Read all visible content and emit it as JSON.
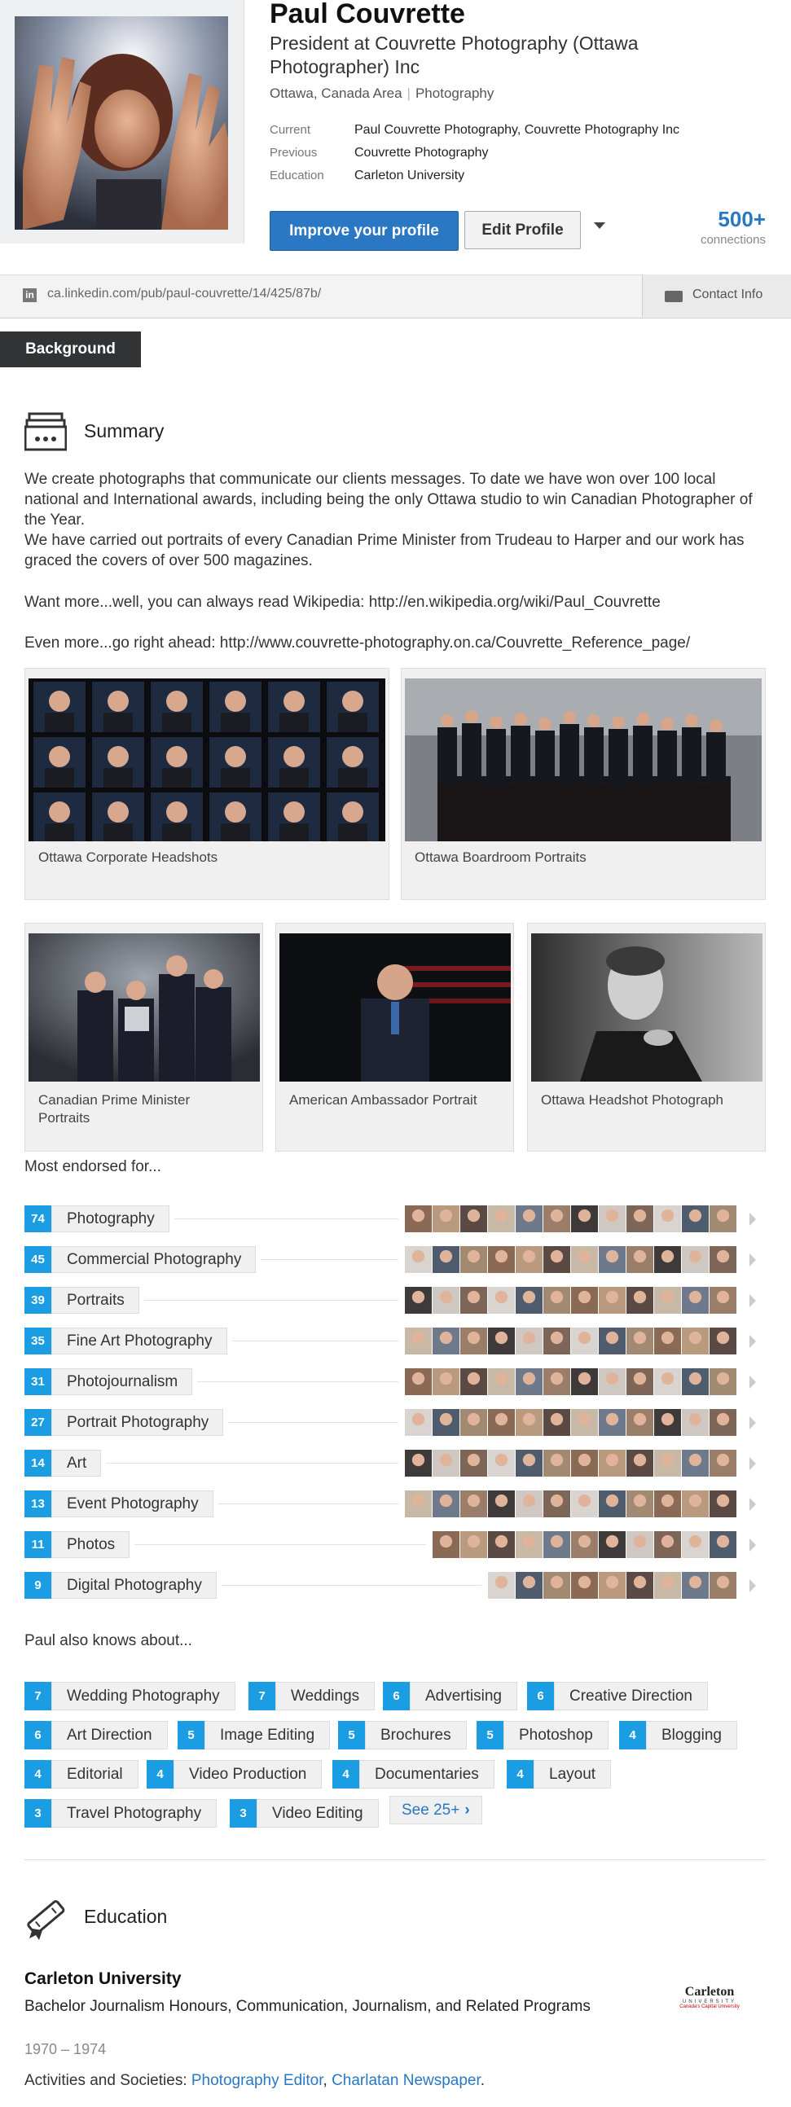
{
  "profile": {
    "name": "Paul Couvrette",
    "headline": "President at Couvrette Photography (Ottawa Photographer) Inc",
    "location": "Ottawa, Canada Area",
    "industry": "Photography",
    "meta": [
      {
        "key": "Current",
        "value": "Paul Couvrette Photography, Couvrette Photography Inc"
      },
      {
        "key": "Previous",
        "value": "Couvrette Photography"
      },
      {
        "key": "Education",
        "value": "Carleton University"
      }
    ],
    "improve_label": "Improve your profile",
    "edit_label": "Edit Profile",
    "connections_count": "500+",
    "connections_label": "connections",
    "public_url": "ca.linkedin.com/pub/paul-couvrette/14/425/87b/",
    "url_icon": "in",
    "contact_label": "Contact Info"
  },
  "tabs": {
    "background": "Background"
  },
  "summary": {
    "title": "Summary",
    "p1": "We create photographs that communicate our clients messages. To date we have won over 100 local national and International awards, including being the only Ottawa studio to win Canadian Photographer of the Year.",
    "p2": "We have carried out portraits of every Canadian Prime Minister from Trudeau to Harper and our work has graced the covers of over 500 magazines.",
    "p3": "Want more...well, you can always read Wikipedia: http://en.wikipedia.org/wiki/Paul_Couvrette",
    "p4": "Even more...go right ahead: http://www.couvrette-photography.on.ca/Couvrette_Reference_page/",
    "media": [
      {
        "caption": "Ottawa Corporate Headshots"
      },
      {
        "caption": "Ottawa Boardroom Portraits"
      },
      {
        "caption": "Canadian Prime Minister Portraits"
      },
      {
        "caption": "American Ambassador Portrait"
      },
      {
        "caption": "Ottawa Headshot Photograph"
      }
    ]
  },
  "endorsements": {
    "title": "Most endorsed for...",
    "skills": [
      {
        "count": "74",
        "name": "Photography"
      },
      {
        "count": "45",
        "name": "Commercial Photography"
      },
      {
        "count": "39",
        "name": "Portraits"
      },
      {
        "count": "35",
        "name": "Fine Art Photography"
      },
      {
        "count": "31",
        "name": "Photojournalism"
      },
      {
        "count": "27",
        "name": "Portrait Photography"
      },
      {
        "count": "14",
        "name": "Art"
      },
      {
        "count": "13",
        "name": "Event Photography"
      },
      {
        "count": "11",
        "name": "Photos"
      },
      {
        "count": "9",
        "name": "Digital Photography"
      }
    ]
  },
  "knows": {
    "title": "Paul also knows about...",
    "chips": [
      {
        "count": "7",
        "name": "Wedding Photography"
      },
      {
        "count": "7",
        "name": "Weddings"
      },
      {
        "count": "6",
        "name": "Advertising"
      },
      {
        "count": "6",
        "name": "Creative Direction"
      },
      {
        "count": "6",
        "name": "Art Direction"
      },
      {
        "count": "5",
        "name": "Image Editing"
      },
      {
        "count": "5",
        "name": "Brochures"
      },
      {
        "count": "5",
        "name": "Photoshop"
      },
      {
        "count": "4",
        "name": "Blogging"
      },
      {
        "count": "4",
        "name": "Editorial"
      },
      {
        "count": "4",
        "name": "Video Production"
      },
      {
        "count": "4",
        "name": "Documentaries"
      },
      {
        "count": "4",
        "name": "Layout"
      },
      {
        "count": "3",
        "name": "Travel Photography"
      },
      {
        "count": "3",
        "name": "Video Editing"
      }
    ],
    "see_more": "See 25+"
  },
  "education": {
    "title": "Education",
    "school": "Carleton University",
    "degree": "Bachelor Journalism Honours, Communication, Journalism, and Related Programs",
    "years": "1970 – 1974",
    "activities_label": "Activities and Societies:",
    "activities": [
      "Photography Editor",
      "Charlatan Newspaper"
    ],
    "logo_word": "Carleton",
    "logo_sub": "UNIVERSITY",
    "logo_tag": "Canada's Capital University"
  },
  "colors": {
    "accent": "#2a77c4",
    "badge": "#1a9de2",
    "tab": "#313335"
  }
}
